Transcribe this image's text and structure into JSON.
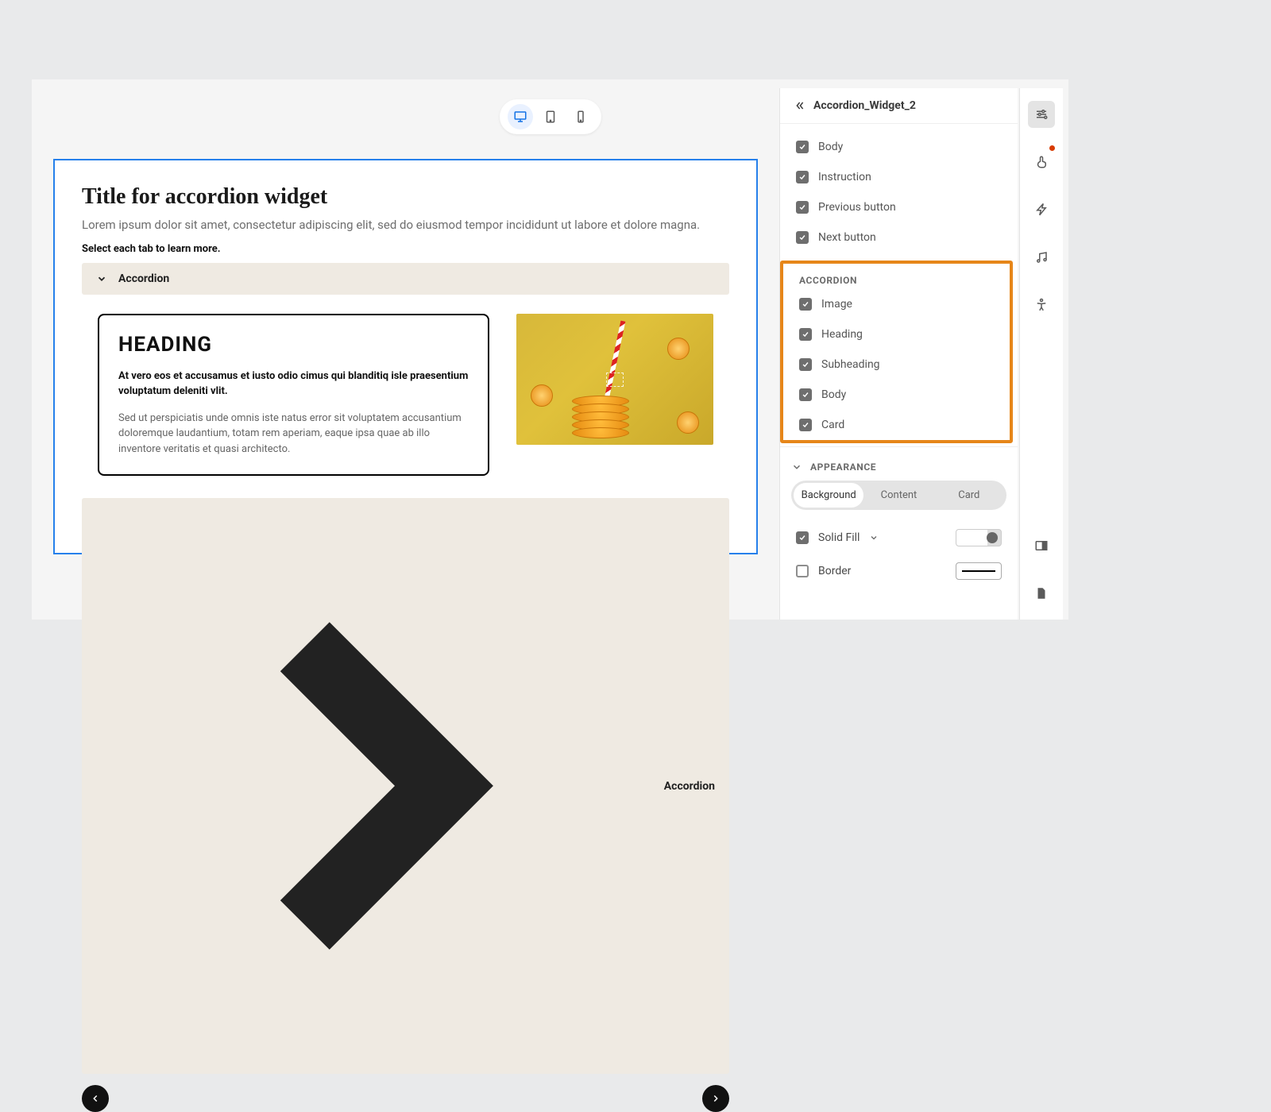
{
  "device_toggle": {
    "desktop_active": true
  },
  "widget": {
    "title": "Title for accordion widget",
    "description": "Lorem ipsum dolor sit amet, consectetur adipiscing elit, sed do eiusmod tempor incididunt ut labore et dolore magna.",
    "instruction": "Select each tab to learn more.",
    "accordion_open_label": "Accordion",
    "accordion_closed_label": "Accordion",
    "content": {
      "heading": "HEADING",
      "subheading": "At vero eos et accusamus et iusto odio cimus qui blanditiq isle praesentium voluptatum deleniti vlit.",
      "body": "Sed ut perspiciatis unde omnis iste natus error sit voluptatem accusantium doloremque laudantium, totam rem aperiam, eaque ipsa quae ab illo inventore veritatis et quasi architecto."
    }
  },
  "panel": {
    "title": "Accordion_Widget_2",
    "elements": {
      "body": {
        "label": "Body",
        "checked": true
      },
      "instruction": {
        "label": "Instruction",
        "checked": true
      },
      "prev": {
        "label": "Previous button",
        "checked": true
      },
      "next": {
        "label": "Next button",
        "checked": true
      }
    },
    "accordion_section": {
      "label": "ACCORDION",
      "image": {
        "label": "Image",
        "checked": true
      },
      "heading": {
        "label": "Heading",
        "checked": true
      },
      "subheading": {
        "label": "Subheading",
        "checked": true
      },
      "body": {
        "label": "Body",
        "checked": true
      },
      "card": {
        "label": "Card",
        "checked": true
      }
    },
    "appearance": {
      "label": "APPEARANCE",
      "tabs": {
        "background": "Background",
        "content": "Content",
        "card": "Card",
        "active": "background"
      },
      "solid_fill": {
        "label": "Solid Fill",
        "checked": true
      },
      "border": {
        "label": "Border",
        "checked": false
      }
    }
  }
}
